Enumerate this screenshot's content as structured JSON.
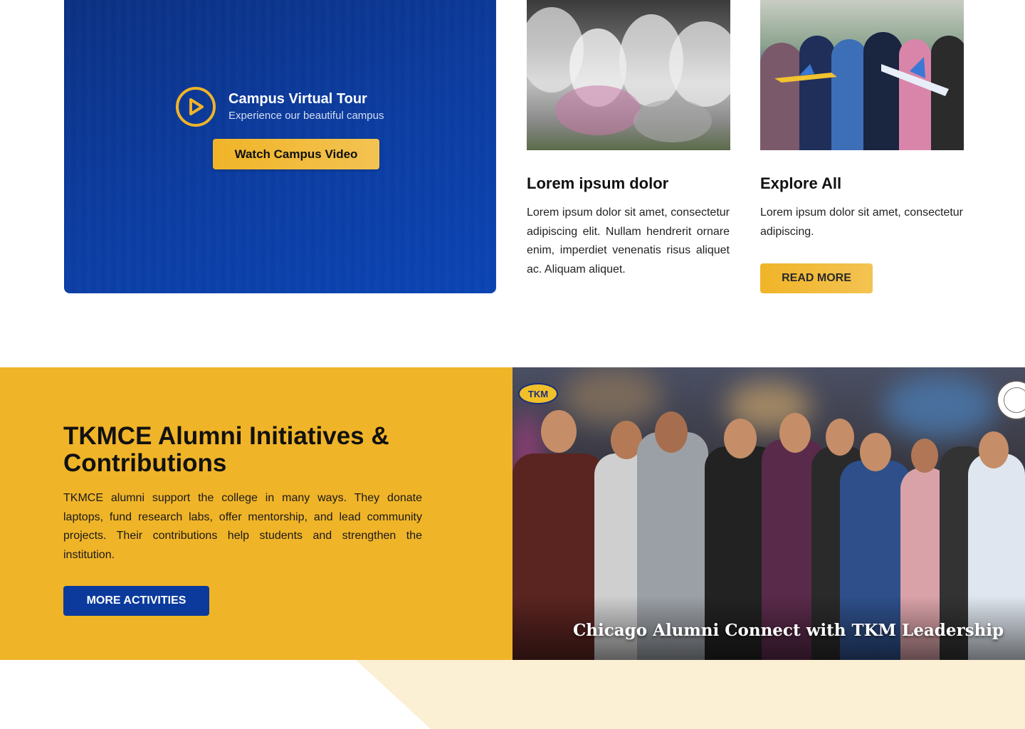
{
  "video_card": {
    "title": "Campus Virtual Tour",
    "subtitle": "Experience our beautiful campus",
    "button_label": "Watch Campus Video"
  },
  "cards": [
    {
      "title": "Lorem ipsum dolor",
      "text": "Lorem ipsum dolor sit amet, consectetur adipiscing elit. Nullam hendrerit ornare enim, imperdiet venenatis risus aliquet ac. Aliquam aliquet."
    },
    {
      "title": "Explore All",
      "text": "Lorem ipsum dolor sit amet, consectetur adipiscing.",
      "button_label": "READ MORE"
    }
  ],
  "alumni": {
    "title": "TKMCE Alumni Initiatives & Contributions",
    "text": "TKMCE alumni support the college in many ways. They donate laptops, fund research labs, offer mentorship, and lead community projects. Their contributions help students and strengthen the institution.",
    "button_label": "MORE ACTIVITIES",
    "photo_caption": "Chicago Alumni Connect with TKM Leadership",
    "badge_text": "TKM"
  },
  "colors": {
    "brand_blue": "#0b3a9c",
    "brand_yellow": "#f0b428",
    "cream": "#fbefd4"
  },
  "icons": {
    "play": "play-circle-icon"
  }
}
